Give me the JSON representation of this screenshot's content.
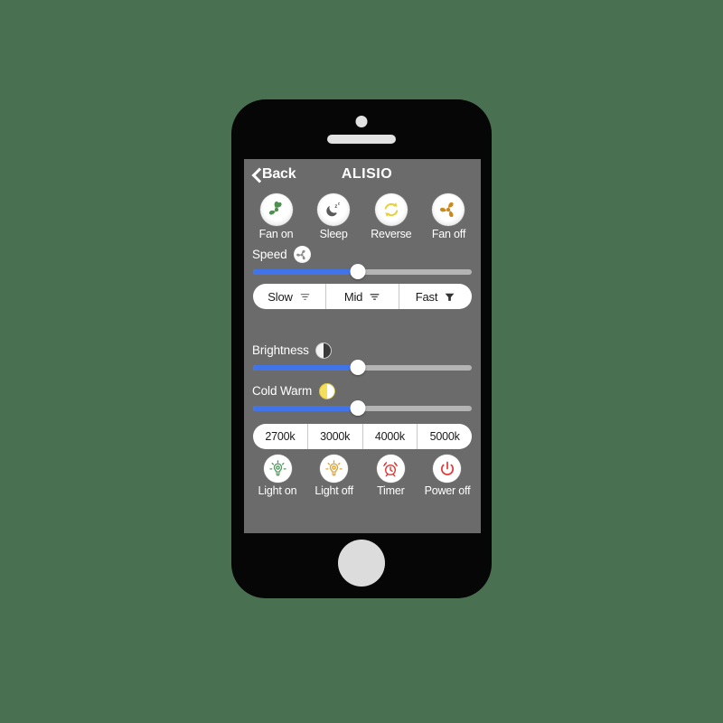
{
  "background_color": "#4a7052",
  "device": {
    "body_color": "#060606",
    "screen_bg": "#6b6b6b",
    "camera_icon": "camera-dot",
    "speaker_icon": "speaker-grille",
    "home_button_icon": "home-button"
  },
  "navbar": {
    "back_label": "Back",
    "back_icon": "chevron-left-icon",
    "title": "ALISIO"
  },
  "fan_actions": [
    {
      "label": "Fan on",
      "icon": "fan-icon",
      "color": "#4f8f4f"
    },
    {
      "label": "Sleep",
      "icon": "moon-sleep-icon",
      "color": "#5a5a5a"
    },
    {
      "label": "Reverse",
      "icon": "reverse-arrows-icon",
      "color": "#e9cf3a"
    },
    {
      "label": "Fan off",
      "icon": "fan-icon",
      "color": "#c98a1e"
    }
  ],
  "speed": {
    "label": "Speed",
    "icon": "fan-speed-icon",
    "slider": {
      "name": "speed-slider",
      "value_percent": 48
    },
    "segments": [
      {
        "label": "Slow",
        "icon": "wind-weak-icon"
      },
      {
        "label": "Mid",
        "icon": "wind-medium-icon"
      },
      {
        "label": "Fast",
        "icon": "wind-strong-icon"
      }
    ]
  },
  "brightness": {
    "label": "Brightness",
    "icon": "half-circle-contrast-icon",
    "slider": {
      "name": "brightness-slider",
      "value_percent": 48
    }
  },
  "cold_warm": {
    "label": "Cold Warm",
    "icon": "half-circle-warm-icon",
    "slider": {
      "name": "cold-warm-slider",
      "value_percent": 48
    }
  },
  "kelvin": {
    "segments": [
      {
        "label": "2700k"
      },
      {
        "label": "3000k"
      },
      {
        "label": "4000k"
      },
      {
        "label": "5000k"
      }
    ]
  },
  "light_actions": [
    {
      "label": "Light on",
      "icon": "bulb-icon",
      "color": "#4f9a5d"
    },
    {
      "label": "Light off",
      "icon": "bulb-icon",
      "color": "#e0a22a"
    },
    {
      "label": "Timer",
      "icon": "alarm-clock-icon",
      "color": "#e23b3b"
    },
    {
      "label": "Power off",
      "icon": "power-icon",
      "color": "#e23b3b"
    }
  ],
  "colors": {
    "slider_fill": "#4174e8",
    "slider_track": "#b4b4b4",
    "segment_bg": "#ffffff",
    "text": "#ffffff"
  }
}
